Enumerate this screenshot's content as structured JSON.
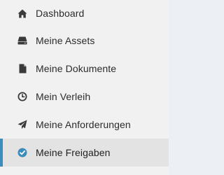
{
  "sidebar": {
    "active_index": 5,
    "accent_color": "#3c8dbc",
    "items": [
      {
        "label": "Dashboard",
        "icon": "home-icon"
      },
      {
        "label": "Meine Assets",
        "icon": "hard-drive-icon"
      },
      {
        "label": "Meine Dokumente",
        "icon": "document-icon"
      },
      {
        "label": "Mein Verleih",
        "icon": "clock-icon"
      },
      {
        "label": "Meine Anforderungen",
        "icon": "paper-plane-icon"
      },
      {
        "label": "Meine Freigaben",
        "icon": "check-circle-icon"
      }
    ]
  }
}
